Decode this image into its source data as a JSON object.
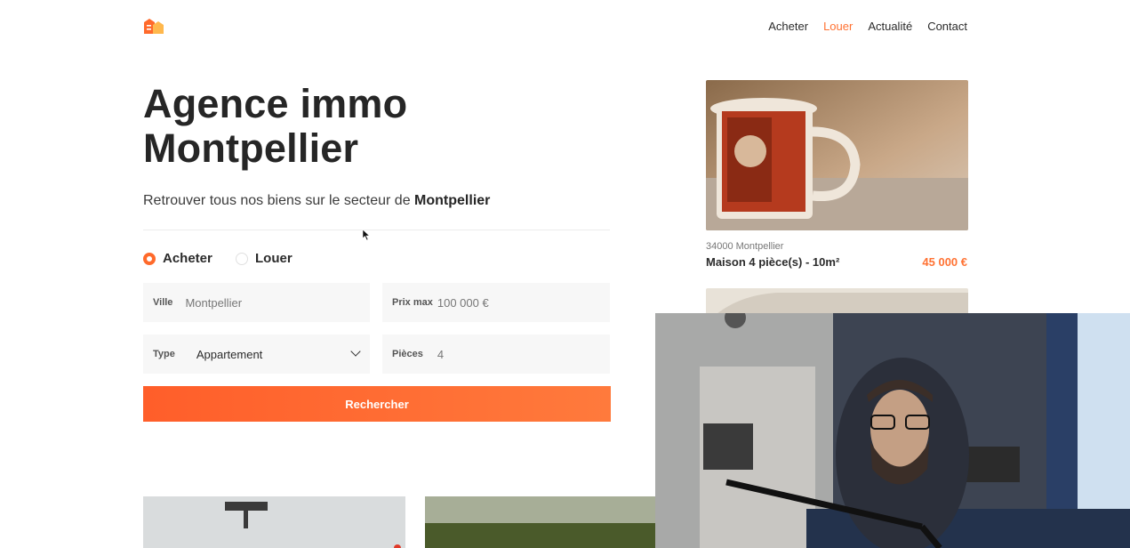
{
  "header": {
    "logo_icon": "house-logo-icon",
    "nav": [
      {
        "label": "Acheter",
        "active": false
      },
      {
        "label": "Louer",
        "active": true
      },
      {
        "label": "Actualité",
        "active": false
      },
      {
        "label": "Contact",
        "active": false
      }
    ]
  },
  "hero": {
    "title_line1": "Agence immo",
    "title_line2": "Montpellier",
    "subtitle_prefix": "Retrouver tous nos biens sur le secteur de ",
    "subtitle_city": "Montpellier"
  },
  "search": {
    "radio_buy": "Acheter",
    "radio_rent": "Louer",
    "selected": "Acheter",
    "ville_label": "Ville",
    "ville_value": "Montpellier",
    "prix_label": "Prix max",
    "prix_value": "100 000 €",
    "type_label": "Type",
    "type_value": "Appartement",
    "pieces_label": "Pièces",
    "pieces_value": "4",
    "submit_label": "Rechercher"
  },
  "listing": {
    "location": "34000 Montpellier",
    "title": "Maison 4 pièce(s) - 10m²",
    "price": "45 000 €"
  },
  "colors": {
    "accent": "#ff7233",
    "button": "#ff6a2b"
  }
}
